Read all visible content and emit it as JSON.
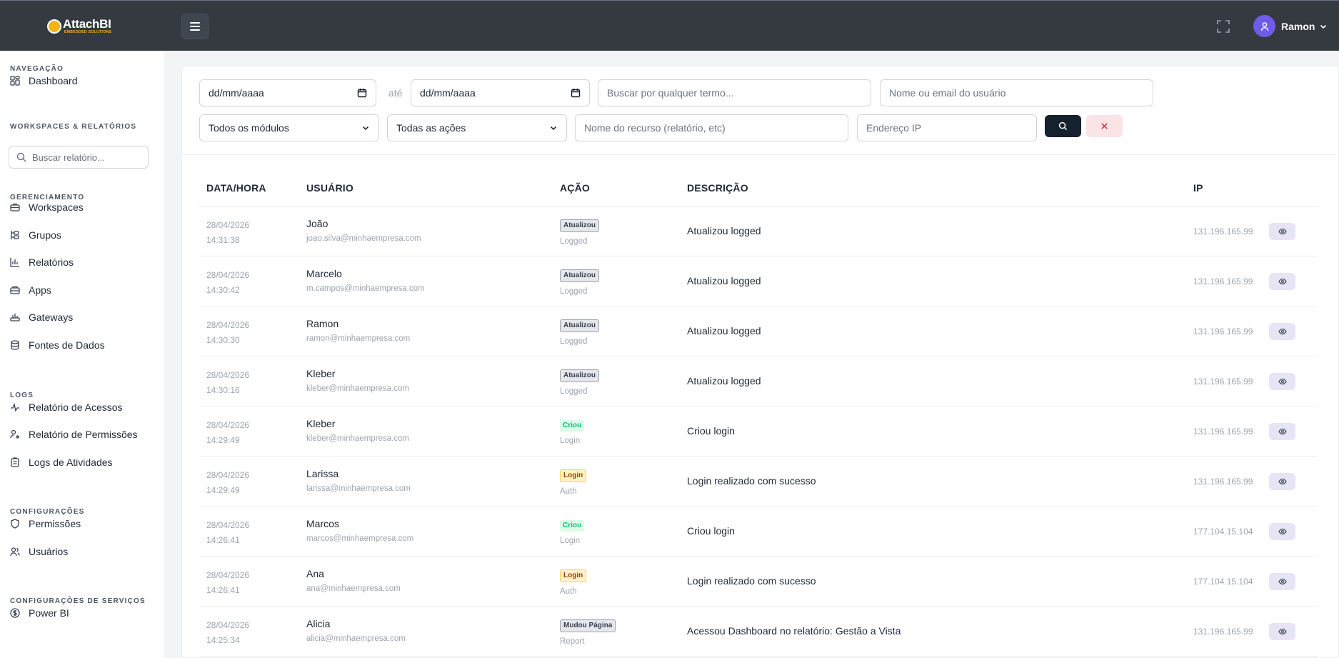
{
  "header": {
    "brand": "AttachBI",
    "brand_sub": "EMBEDDED SOLUTIONS",
    "user_name": "Ramon",
    "colors": {
      "topbar": "#343a40",
      "brand_accent": "#f5b516",
      "avatar": "#6c5ce7"
    },
    "icons": {
      "menu": "hamburger-icon",
      "fullscreen": "fullscreen-icon",
      "user": "user-icon",
      "caret": "chevron-down-icon"
    }
  },
  "sidebar": {
    "sections": [
      {
        "title": "NAVEGAÇÃO",
        "items": [
          {
            "label": "Dashboard",
            "icon": "grid-icon"
          }
        ]
      },
      {
        "title": "WORKSPACES & RELATÓRIOS",
        "search_placeholder": "Buscar relatório..."
      },
      {
        "title": "GERENCIAMENTO",
        "items": [
          {
            "label": "Workspaces",
            "icon": "briefcase-icon"
          },
          {
            "label": "Grupos",
            "icon": "hierarchy-icon"
          },
          {
            "label": "Relatórios",
            "icon": "bar-chart-icon"
          },
          {
            "label": "Apps",
            "icon": "app-box-icon"
          },
          {
            "label": "Gateways",
            "icon": "router-icon"
          },
          {
            "label": "Fontes de Dados",
            "icon": "database-icon"
          }
        ]
      },
      {
        "title": "LOGS",
        "items": [
          {
            "label": "Relatório de Acessos",
            "icon": "activity-icon"
          },
          {
            "label": "Relatório de Permissões",
            "icon": "user-key-icon"
          },
          {
            "label": "Logs de Atividades",
            "icon": "clipboard-icon"
          }
        ]
      },
      {
        "title": "CONFIGURAÇÕES",
        "items": [
          {
            "label": "Permissões",
            "icon": "shield-icon"
          },
          {
            "label": "Usuários",
            "icon": "users-icon"
          }
        ]
      },
      {
        "title": "CONFIGURAÇÕES DE SERVIÇOS",
        "items": [
          {
            "label": "Power BI",
            "icon": "dollar-circle-icon"
          }
        ]
      }
    ]
  },
  "filters": {
    "date_from": "dd/mm/aaaa",
    "date_sep": "até",
    "date_to": "dd/mm/aaaa",
    "term_placeholder": "Buscar por qualquer termo...",
    "user_placeholder": "Nome ou email do usuário",
    "module_selected": "Todos os módulos",
    "action_selected": "Todas as ações",
    "resource_placeholder": "Nome do recurso (relatório, etc)",
    "ip_placeholder": "Endereço IP",
    "colors": {
      "search_button": "#16212e",
      "clear_button": "#fbe3e6"
    }
  },
  "table": {
    "columns": [
      "DATA/HORA",
      "USUÁRIO",
      "AÇÃO",
      "DESCRIÇÃO",
      "IP"
    ],
    "rows": [
      {
        "date": "28/04/2026",
        "time": "14:31:38",
        "name": "João",
        "email": "joao.silva@minhaempresa.com",
        "action": "Atualizou",
        "action_style": "default",
        "module": "Logged",
        "description": "Atualizou logged",
        "ip": "131.196.165.99"
      },
      {
        "date": "28/04/2026",
        "time": "14:30:42",
        "name": "Marcelo",
        "email": "m.campos@minhaempresa.com",
        "action": "Atualizou",
        "action_style": "default",
        "module": "Logged",
        "description": "Atualizou logged",
        "ip": "131.196.165.99"
      },
      {
        "date": "28/04/2026",
        "time": "14:30:30",
        "name": "Ramon",
        "email": "ramon@minhaempresa.com",
        "action": "Atualizou",
        "action_style": "default",
        "module": "Logged",
        "description": "Atualizou logged",
        "ip": "131.196.165.99"
      },
      {
        "date": "28/04/2026",
        "time": "14:30:16",
        "name": "Kleber",
        "email": "kleber@minhaempresa.com",
        "action": "Atualizou",
        "action_style": "default",
        "module": "Logged",
        "description": "Atualizou logged",
        "ip": "131.196.165.99"
      },
      {
        "date": "28/04/2026",
        "time": "14:29:49",
        "name": "Kleber",
        "email": "kleber@minhaempresa.com",
        "action": "Criou",
        "action_style": "green",
        "module": "Login",
        "description": "Criou login",
        "ip": "131.196.165.99"
      },
      {
        "date": "28/04/2026",
        "time": "14:29:49",
        "name": "Larissa",
        "email": "larissa@minhaempresa.com",
        "action": "Login",
        "action_style": "yellow",
        "module": "Auth",
        "description": "Login realizado com sucesso",
        "ip": "131.196.165.99"
      },
      {
        "date": "28/04/2026",
        "time": "14:26:41",
        "name": "Marcos",
        "email": "marcos@minhaempresa.com",
        "action": "Criou",
        "action_style": "green",
        "module": "Login",
        "description": "Criou login",
        "ip": "177.104.15.104"
      },
      {
        "date": "28/04/2026",
        "time": "14:26:41",
        "name": "Ana",
        "email": "ana@minhaempresa.com",
        "action": "Login",
        "action_style": "yellow",
        "module": "Auth",
        "description": "Login realizado com sucesso",
        "ip": "177.104.15.104"
      },
      {
        "date": "28/04/2026",
        "time": "14:25:34",
        "name": "Alicia",
        "email": "alicia@minhaempresa.com",
        "action": "Mudou Página",
        "action_style": "default",
        "module": "Report",
        "description": "Acessou Dashboard no relatório: Gestão a Vista",
        "ip": "131.196.165.99"
      }
    ]
  }
}
